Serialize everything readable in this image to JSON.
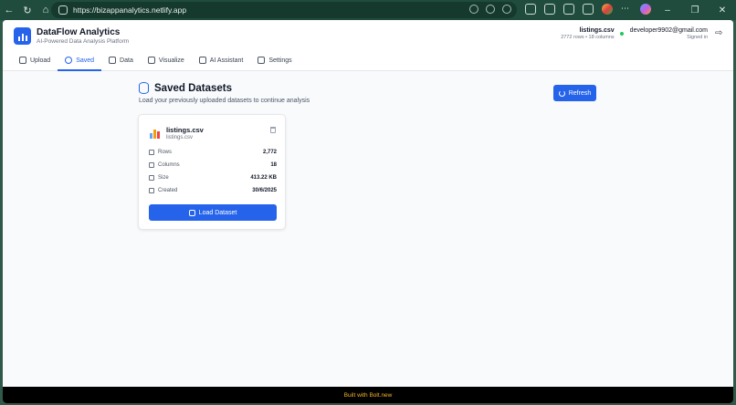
{
  "browser": {
    "url": "https://bizappanalytics.netlify.app"
  },
  "app": {
    "title": "DataFlow Analytics",
    "subtitle": "AI-Powered Data Analysis Platform"
  },
  "header": {
    "dataset_name": "listings.csv",
    "dataset_meta": "2772 rows • 18 columns",
    "user_email": "developer9902@gmail.com",
    "user_status": "Signed in"
  },
  "tabs": [
    {
      "label": "Upload"
    },
    {
      "label": "Saved"
    },
    {
      "label": "Data"
    },
    {
      "label": "Visualize"
    },
    {
      "label": "AI Assistant"
    },
    {
      "label": "Settings"
    }
  ],
  "page": {
    "title": "Saved Datasets",
    "subtitle": "Load your previously uploaded datasets to continue analysis",
    "refresh_label": "Refresh"
  },
  "dataset_card": {
    "name": "listings.csv",
    "filename": "listings.csv",
    "stats": [
      {
        "label": "Rows",
        "value": "2,772",
        "icon": "users-icon"
      },
      {
        "label": "Columns",
        "value": "18",
        "icon": "file-text-icon"
      },
      {
        "label": "Size",
        "value": "413.22 KB",
        "icon": "download-icon"
      },
      {
        "label": "Created",
        "value": "30/6/2025",
        "icon": "calendar-icon"
      }
    ],
    "load_label": "Load Dataset"
  },
  "footer": {
    "text": "Built with Bolt.new"
  },
  "colors": {
    "accent": "#2563eb",
    "footer_text": "#f0b429",
    "online": "#22c55e"
  }
}
